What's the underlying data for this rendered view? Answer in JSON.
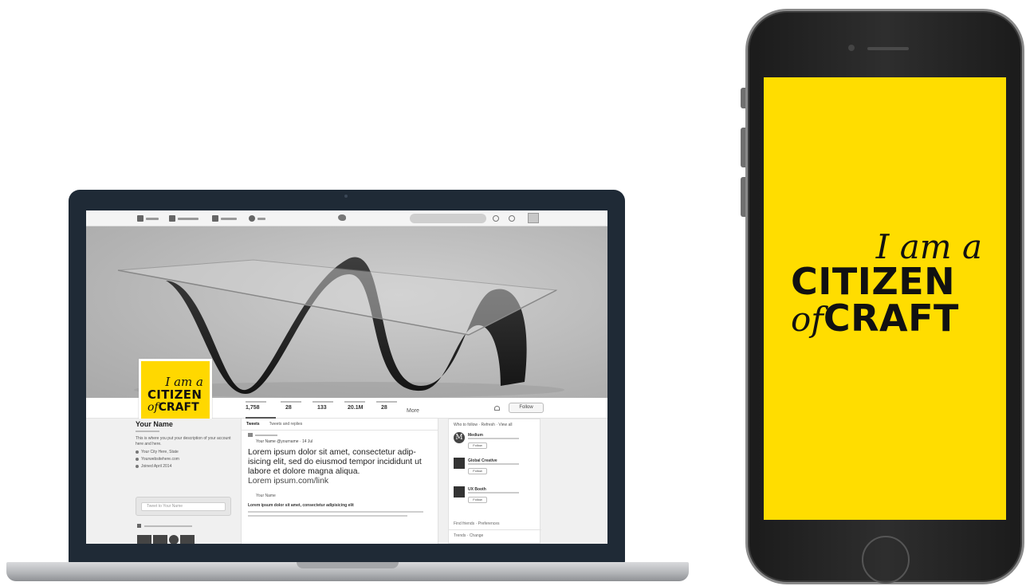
{
  "laptop": {
    "profile": {
      "avatar": {
        "line1": "I am a",
        "line2": "CITIZEN",
        "of": "of",
        "craft": "CRAFT"
      },
      "name": "Your Name",
      "bio": "This is where you put your description of your account here and here.",
      "location": "Your City Here, State",
      "website": "Yourwebsitehere.com",
      "joined": "Joined April 2014",
      "tweet_placeholder": "Tweet to Your Name"
    },
    "stats": [
      {
        "value": "1,758"
      },
      {
        "value": "28"
      },
      {
        "value": "133"
      },
      {
        "value": "20.1M"
      },
      {
        "value": "28"
      }
    ],
    "more_label": "More",
    "follow_label": "Follow",
    "tabs": [
      "Tweets",
      "Tweets and replies"
    ],
    "tweet": {
      "author": "Your Name @yourname · 14 Jul",
      "text": "Lorem ipsum dolor sit amet, consectetur adip-isicing elit, sed do eiusmod tempor incididunt ut labore et dolore magna aliqua.",
      "link": "Lorem ipsum.com/link",
      "subauthor": "Your Name",
      "body": "Lorem ipsum dolor sit amet, consectetur adipisicing elit"
    },
    "sidebar": {
      "heading": "Who to follow · Refresh · View all",
      "suggestions": [
        {
          "name": "Medium",
          "follow": "Follow"
        },
        {
          "name": "Global Creative",
          "follow": "Follow"
        },
        {
          "name": "UX Booth",
          "follow": "Follow"
        }
      ],
      "find_friends": "Find friends · Preferences",
      "trends": "Trends · Change"
    }
  },
  "phone": {
    "line1": "I am a",
    "line2": "CITIZEN",
    "of": "of",
    "craft": "CRAFT"
  },
  "colors": {
    "brand_yellow": "#ffdd00",
    "device_dark": "#1f2a36"
  }
}
